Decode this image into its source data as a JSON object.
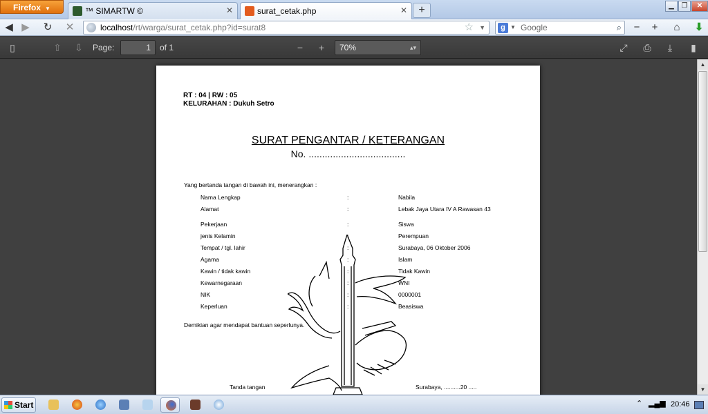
{
  "browser": {
    "menu_label": "Firefox",
    "tabs": [
      {
        "title": "™ SIMARTW ©",
        "active": false
      },
      {
        "title": "surat_cetak.php",
        "active": true
      }
    ],
    "url_host": "localhost",
    "url_path": "/rt/warga/surat_cetak.php?id=surat8",
    "search_engine": "Google",
    "search_placeholder": "Google"
  },
  "pdf_toolbar": {
    "page_label": "Page:",
    "page_value": "1",
    "page_of": "of 1",
    "zoom": "70%"
  },
  "document": {
    "rt_rw": "RT : 04 | RW : 05",
    "kelurahan": "KELURAHAN : Dukuh Setro",
    "title": "SURAT PENGANTAR / KETERANGAN",
    "number": "No. ....................................",
    "intro": "Yang bertanda tangan di bawah ini, menerangkan :",
    "fields": [
      {
        "label": "Nama Lengkap",
        "colon": ":",
        "value": "Nabila"
      },
      {
        "label": "Alamat",
        "colon": ":",
        "value": "Lebak Jaya Utara IV A Rawasan 43"
      },
      {
        "label": "Pekerjaan",
        "colon": ":",
        "value": "Siswa"
      },
      {
        "label": "jenis Kelamin",
        "colon": ":",
        "value": "Perempuan"
      },
      {
        "label": "Tempat / tgl. lahir",
        "colon": ":",
        "value": "Surabaya, 06 Oktober 2006"
      },
      {
        "label": "Agama",
        "colon": ":",
        "value": "Islam"
      },
      {
        "label": "Kawin / tidak kawin",
        "colon": ":",
        "value": "Tidak Kawin"
      },
      {
        "label": "Kewarnegaraan",
        "colon": ":",
        "value": "WNI"
      },
      {
        "label": "NIK",
        "colon": ":",
        "value": "0000001"
      },
      {
        "label": "Keperluan",
        "colon": ":",
        "value": "Beasiswa"
      }
    ],
    "closing": "Demikian agar mendapat bantuan seperlunya.",
    "signature_left": "Tanda tangan",
    "signature_right": "Surabaya, ..........20 ....."
  },
  "taskbar": {
    "start_label": "Start",
    "clock": "20:46"
  }
}
